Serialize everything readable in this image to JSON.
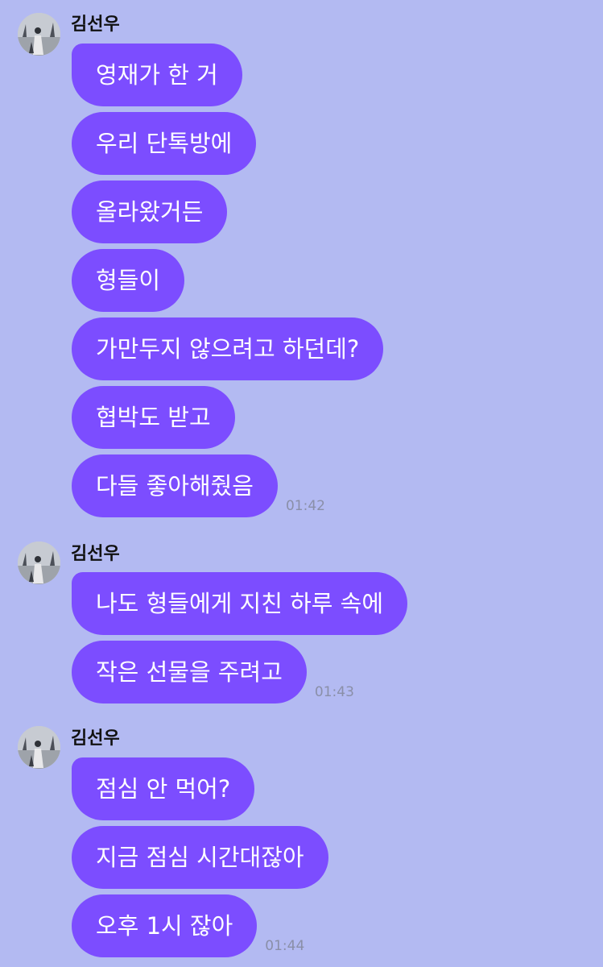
{
  "colors": {
    "background": "#B3BAF2",
    "bubble": "#7C4DFF",
    "bubble_text": "#FFFFFF",
    "sender_text": "#111111",
    "time_text": "#8A8FA8"
  },
  "groups": [
    {
      "sender": "김선우",
      "avatar_icon": "profile-photo-avatar",
      "messages": [
        {
          "text": "영재가 한 거"
        },
        {
          "text": "우리 단톡방에"
        },
        {
          "text": "올라왔거든"
        },
        {
          "text": "형들이"
        },
        {
          "text": "가만두지 않으려고 하던데?"
        },
        {
          "text": "협박도 받고"
        },
        {
          "text": "다들 좋아해줬음",
          "time": "01:42"
        }
      ]
    },
    {
      "sender": "김선우",
      "avatar_icon": "profile-photo-avatar",
      "messages": [
        {
          "text": "나도 형들에게 지친 하루 속에"
        },
        {
          "text": "작은 선물을 주려고",
          "time": "01:43"
        }
      ]
    },
    {
      "sender": "김선우",
      "avatar_icon": "profile-photo-avatar",
      "messages": [
        {
          "text": "점심 안 먹어?"
        },
        {
          "text": "지금 점심 시간대잖아"
        },
        {
          "text": "오후 1시 잖아",
          "time": "01:44"
        }
      ]
    }
  ]
}
